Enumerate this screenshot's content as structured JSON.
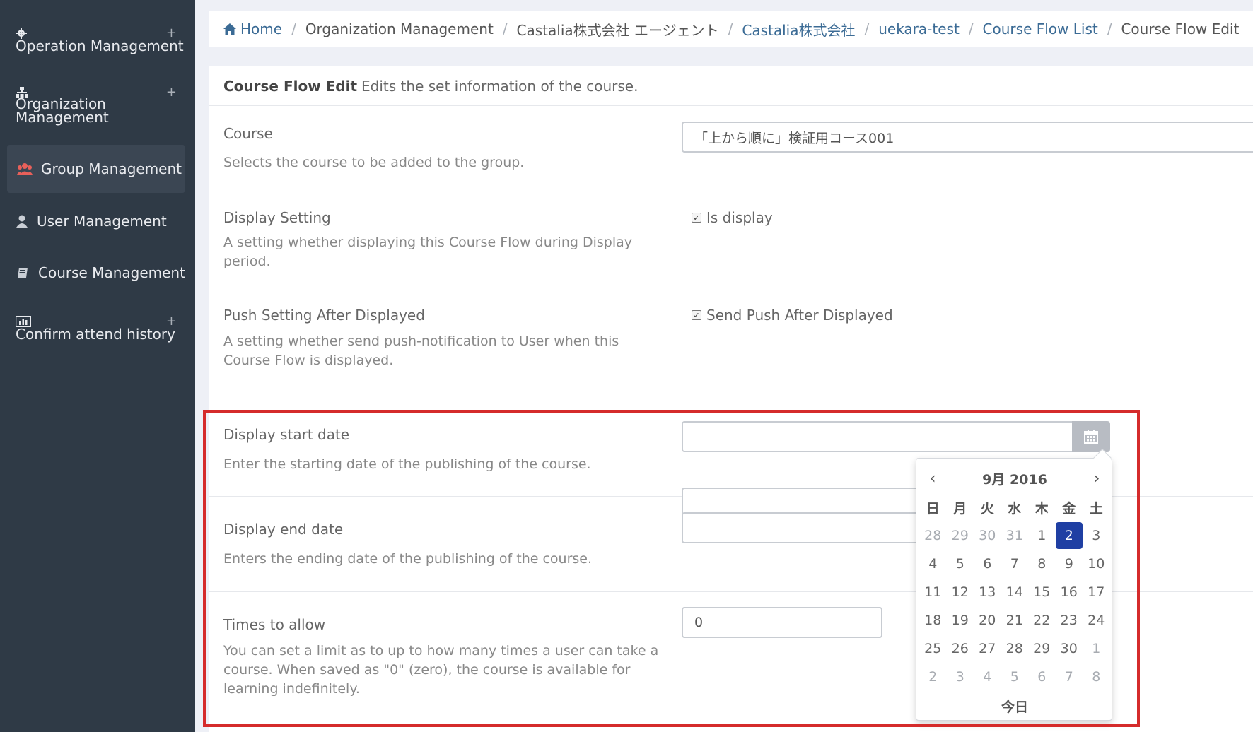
{
  "sidebar": {
    "items": [
      {
        "label": "Operation Management",
        "icon": "gear-icon",
        "expand": "+"
      },
      {
        "label_line1": "Organization",
        "label_line2": "Management",
        "icon": "sitemap-icon",
        "expand": "+"
      },
      {
        "label": "Group Management",
        "icon": "users-icon",
        "active": true
      },
      {
        "label": "User Management",
        "icon": "user-icon"
      },
      {
        "label": "Course Management",
        "icon": "book-icon"
      },
      {
        "label": "Confirm attend history",
        "icon": "bar-chart-icon",
        "expand": "+"
      }
    ]
  },
  "breadcrumb": {
    "items": [
      "Home",
      "Organization Management",
      "Castalia株式会社 エージェント",
      "Castalia株式会社",
      "uekara-test",
      "Course Flow List",
      "Course Flow Edit"
    ],
    "separator": "/"
  },
  "panel": {
    "title": "Course Flow Edit",
    "subtitle": "Edits the set information of the course."
  },
  "form": {
    "course": {
      "label": "Course",
      "help": "Selects the course to be added to the group.",
      "value": "「上から順に」検証用コース001"
    },
    "display_setting": {
      "label": "Display Setting",
      "help": "A setting whether displaying this Course Flow during Display period.",
      "checkbox_label": "Is display",
      "checked": true
    },
    "push_setting": {
      "label": "Push Setting After Displayed",
      "help": "A setting whether send push-notification to User when this Course Flow is displayed.",
      "checkbox_label": "Send Push After Displayed",
      "checked": true
    },
    "start_date": {
      "label": "Display start date",
      "help": "Enter the starting date of the publishing of the course.",
      "value": ""
    },
    "end_date": {
      "label": "Display end date",
      "help": "Enters the ending date of the publishing of the course.",
      "value": ""
    },
    "times_to_allow": {
      "label": "Times to allow",
      "help": "You can set a limit as to up to how many times a user can take a course. When saved as \"0\" (zero), the course is available for learning indefinitely.",
      "value": "0"
    }
  },
  "datepicker": {
    "title": "9月 2016",
    "weekdays": [
      "日",
      "月",
      "火",
      "水",
      "木",
      "金",
      "土"
    ],
    "weeks": [
      [
        "28",
        "29",
        "30",
        "31",
        "1",
        "2",
        "3"
      ],
      [
        "4",
        "5",
        "6",
        "7",
        "8",
        "9",
        "10"
      ],
      [
        "11",
        "12",
        "13",
        "14",
        "15",
        "16",
        "17"
      ],
      [
        "18",
        "19",
        "20",
        "21",
        "22",
        "23",
        "24"
      ],
      [
        "25",
        "26",
        "27",
        "28",
        "29",
        "30",
        "1"
      ],
      [
        "2",
        "3",
        "4",
        "5",
        "6",
        "7",
        "8"
      ]
    ],
    "selected_day": "2",
    "today_label": "今日",
    "prev": "‹",
    "next": "›"
  },
  "colors": {
    "sidebar_bg": "#2f3a46",
    "group_icon": "#e8605a",
    "link": "#3b6b95",
    "selected_day": "#1f3fa3",
    "highlight": "#d52b2b"
  }
}
